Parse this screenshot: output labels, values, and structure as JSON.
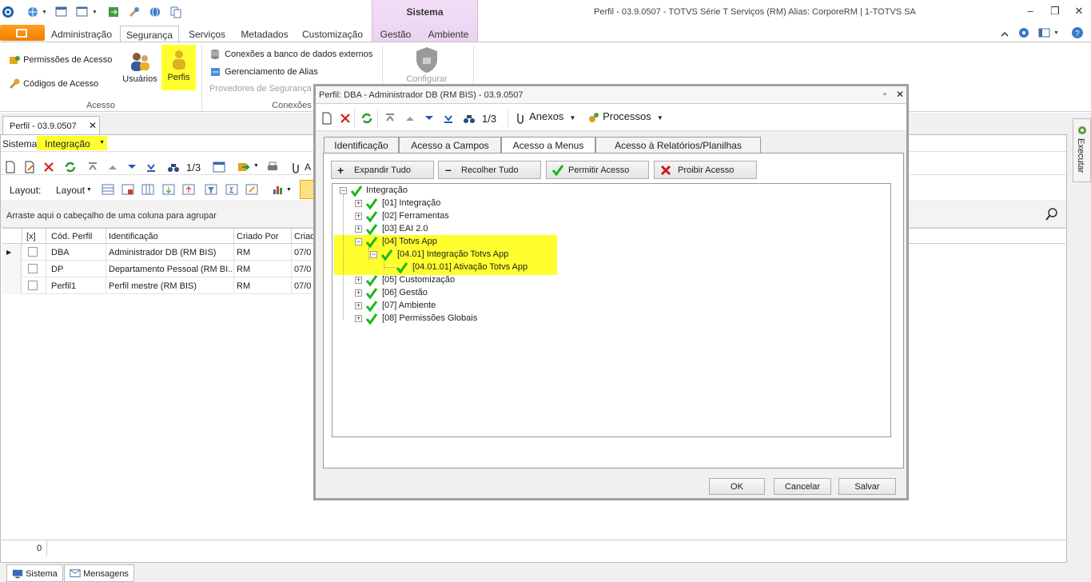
{
  "window": {
    "title": "Perfil - 03.9.0507 - TOTVS Série T Serviços (RM) Alias: CorporeRM | 1-TOTVS SA",
    "context_tab": "Sistema"
  },
  "ribbon": {
    "tabs": [
      "Administração",
      "Segurança",
      "Serviços",
      "Metadados",
      "Customização",
      "Gestão",
      "Ambiente"
    ],
    "active_tab": "Segurança",
    "acesso": {
      "label": "Acesso",
      "permissoes": "Permissões de Acesso",
      "codigos": "Códigos de Acesso",
      "usuarios": "Usuários",
      "perfis": "Perfis"
    },
    "conexoes": {
      "label": "Conexões",
      "bd_externos": "Conexões a banco de dados externos",
      "alias": "Gerenciamento de Alias",
      "provedores": "Provedores de Segurança"
    },
    "configurar": "Configurar"
  },
  "document": {
    "tab_label": "Perfil - 03.9.0507",
    "sistema_label": "Sistema:",
    "sistema_value": "Integração",
    "record_nav": "1/3",
    "layout_label": "Layout:",
    "layout_menu": "Layout",
    "group_hint": "Arraste aqui o cabeçalho de uma coluna para agrupar",
    "columns": [
      "[x]",
      "Cód. Perfil",
      "Identificação",
      "Criado Por",
      "Criad"
    ],
    "rows": [
      {
        "cod": "DBA",
        "ident": "Administrador DB (RM BIS)",
        "criado_por": "RM",
        "criado": "07/0"
      },
      {
        "cod": "DP",
        "ident": "Departamento Pessoal (RM BI...",
        "criado_por": "RM",
        "criado": "07/0"
      },
      {
        "cod": "Perfil1",
        "ident": "Perfil mestre (RM BIS)",
        "criado_por": "RM",
        "criado": "07/0"
      }
    ],
    "status_count": "0",
    "partial_btn": "A"
  },
  "bottom_tabs": {
    "sistema": "Sistema",
    "mensagens": "Mensagens"
  },
  "side_panel": {
    "executar": "Executar"
  },
  "modal": {
    "title": "Perfil: DBA - Administrador DB (RM BIS) - 03.9.0507",
    "record_nav": "1/3",
    "anexos": "Anexos",
    "processos": "Processos",
    "tabs": [
      "Identificação",
      "Acesso a Campos",
      "Acesso a Menus",
      "Acesso à Relatórios/Planilhas"
    ],
    "active_tab": "Acesso a Menus",
    "buttons": {
      "expandir": "Expandir Tudo",
      "recolher": "Recolher Tudo",
      "permitir": "Permitir Acesso",
      "proibir": "Proibir Acesso"
    },
    "tree": {
      "root": "Integração",
      "n01": "[01] Integração",
      "n02": "[02] Ferramentas",
      "n03": "[03] EAI 2.0",
      "n04": "[04] Totvs App",
      "n0401": "[04.01] Integração Totvs App",
      "n040101": "[04.01.01] Ativação Totvs App",
      "n05": "[05] Customização",
      "n06": "[06] Gestão",
      "n07": "[07] Ambiente",
      "n08": "[08] Permissões Globais"
    },
    "footer": {
      "ok": "OK",
      "cancelar": "Cancelar",
      "salvar": "Salvar"
    }
  },
  "colors": {
    "highlight": "#ffff30",
    "check": "#18b818",
    "accent_orange": "#f07d00",
    "context_purple": "#ead3f1"
  }
}
